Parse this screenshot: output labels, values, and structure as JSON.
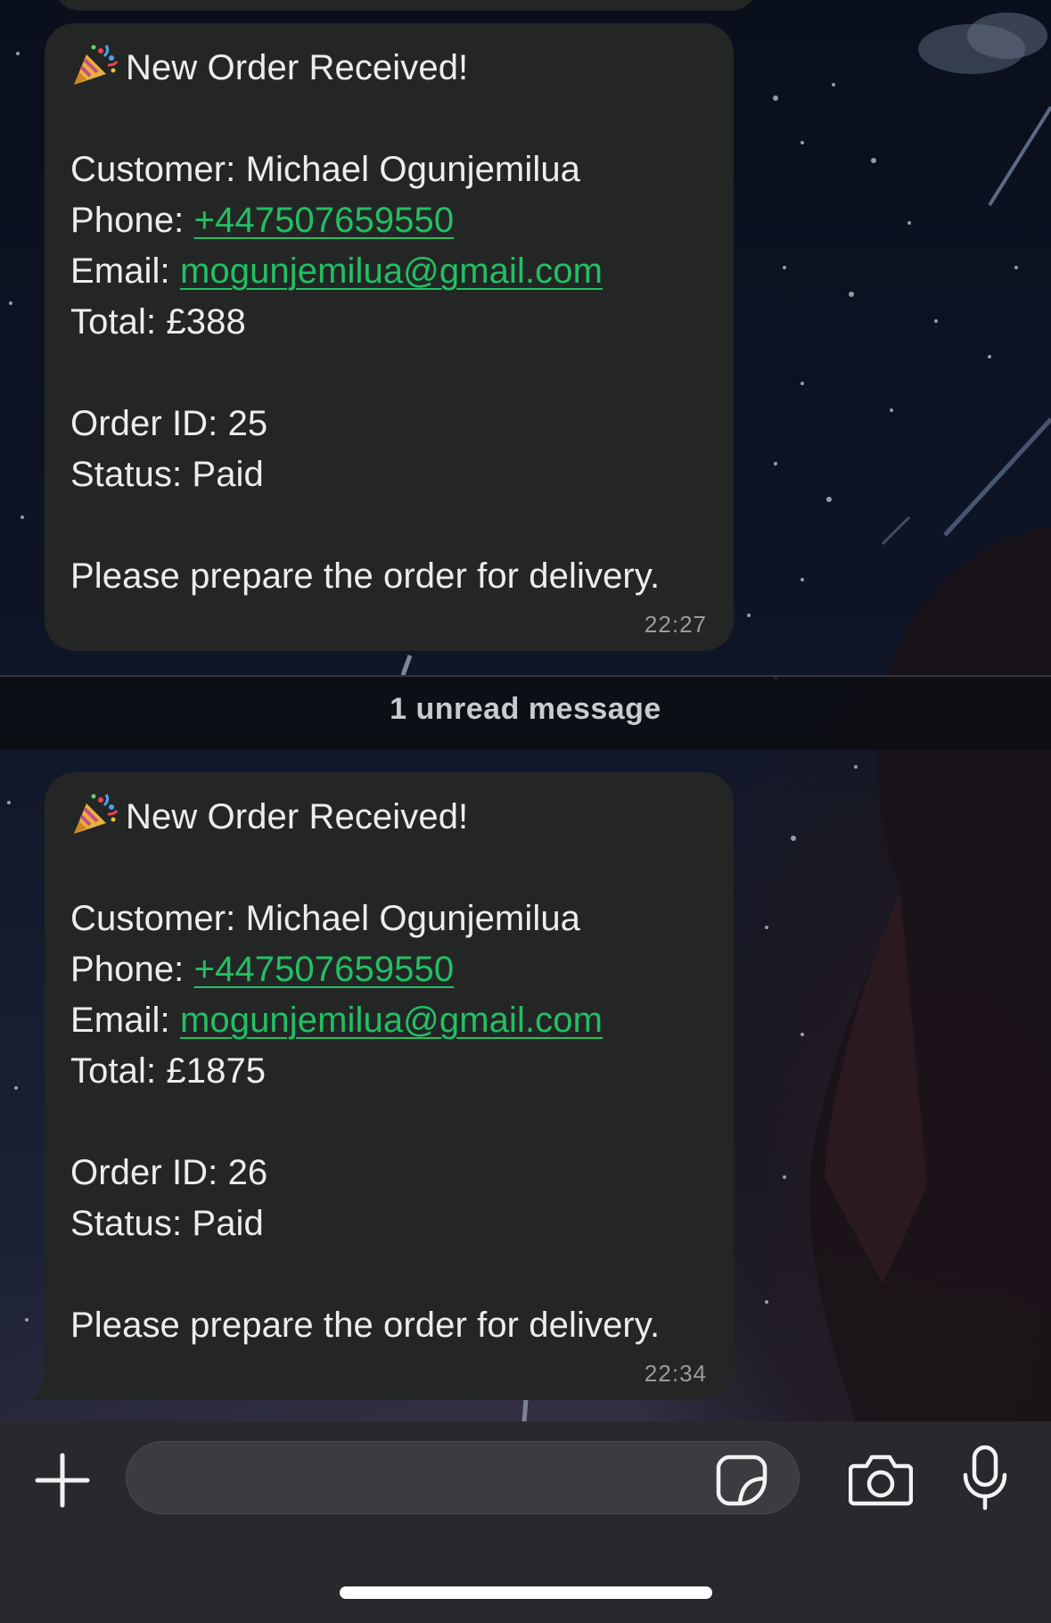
{
  "messages": [
    {
      "emoji": "party-popper-icon",
      "title": "New Order Received!",
      "customer_line": "Customer: Michael Ogunjemilua",
      "phone_label": "Phone: ",
      "phone": "+447507659550",
      "email_label": "Email: ",
      "email": "mogunjemilua@gmail.com",
      "total_line": "Total: £388",
      "order_line": "Order ID: 25",
      "status_line": "Status: Paid",
      "instruction": "Please prepare the order for delivery.",
      "time": "22:27"
    },
    {
      "emoji": "party-popper-icon",
      "title": "New Order Received!",
      "customer_line": "Customer: Michael Ogunjemilua",
      "phone_label": "Phone: ",
      "phone": "+447507659550",
      "email_label": "Email: ",
      "email": "mogunjemilua@gmail.com",
      "total_line": "Total: £1875",
      "order_line": "Order ID: 26",
      "status_line": "Status: Paid",
      "instruction": "Please prepare the order for delivery.",
      "time": "22:34"
    }
  ],
  "unread_divider": "1 unread message",
  "composer": {
    "input_value": "",
    "icons": [
      "plus-icon",
      "sticker-icon",
      "camera-icon",
      "microphone-icon"
    ]
  },
  "colors": {
    "bubble": "#242626",
    "link": "#21c063",
    "composer": "#2a272d"
  }
}
